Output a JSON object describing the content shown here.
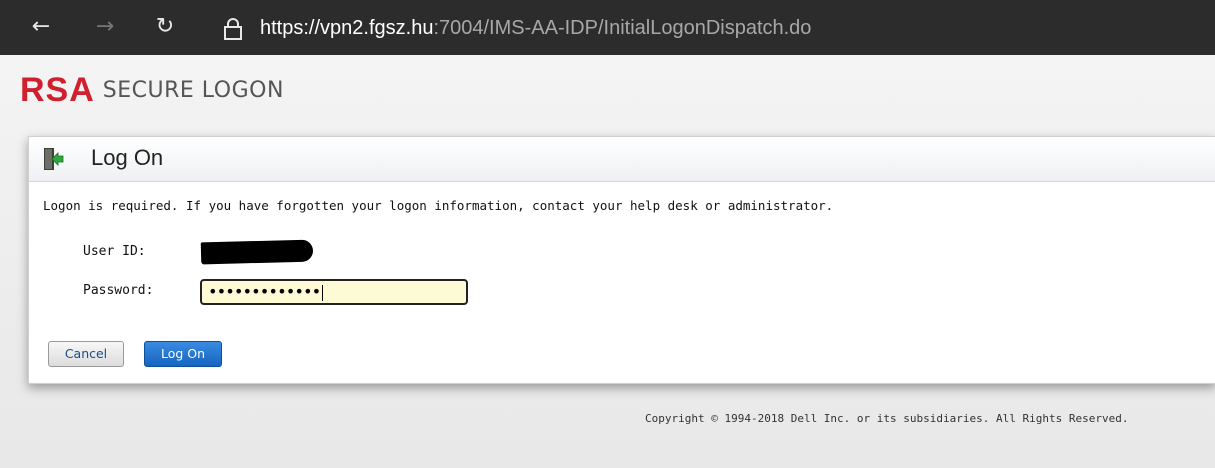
{
  "browser": {
    "url_scheme": "https://",
    "url_host": "vpn2.fgsz.hu",
    "url_rest": ":7004/IMS-AA-IDP/InitialLogonDispatch.do",
    "back_icon": "←",
    "forward_icon": "→",
    "refresh_icon": "↻"
  },
  "brand": {
    "logo": "RSA",
    "subtitle": "SECURE LOGON"
  },
  "panel": {
    "title": "Log On",
    "info": "Logon is required. If you have forgotten your logon information, contact your help desk or administrator.",
    "user_id_label": "User ID:",
    "password_label": "Password:",
    "password_value": "•••••••••••••",
    "cancel_label": "Cancel",
    "logon_label": "Log On"
  },
  "footer": {
    "copyright": "Copyright © 1994-2018 Dell Inc. or its subsidiaries. All Rights Reserved."
  },
  "colors": {
    "brand_red": "#d0202e",
    "primary_button": "#1665c1",
    "input_highlight": "#fdfbd6"
  }
}
